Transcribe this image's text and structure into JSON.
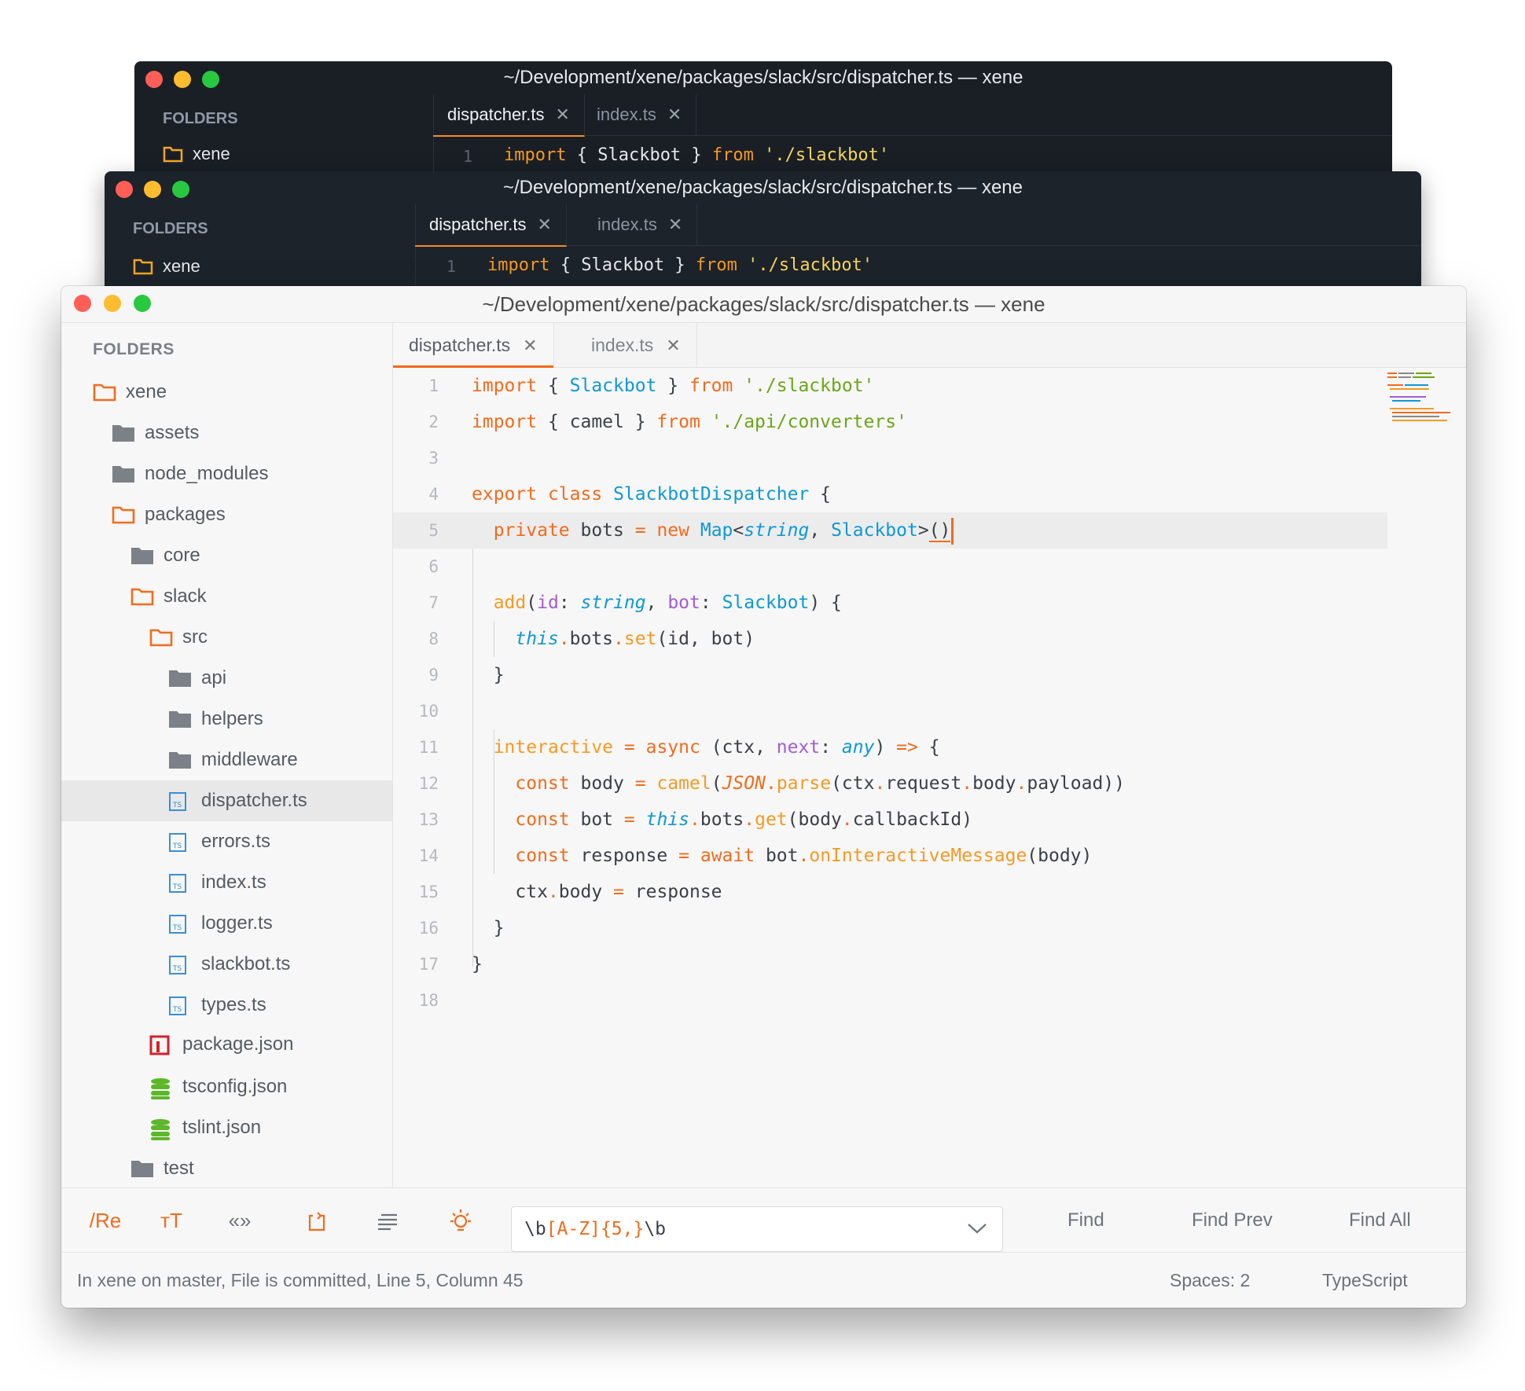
{
  "window_title": "~/Development/xene/packages/slack/src/dispatcher.ts — xene",
  "sidebar_header": "FOLDERS",
  "tabs": [
    {
      "label": "dispatcher.ts",
      "close": "✕"
    },
    {
      "label": "index.ts",
      "close": "✕"
    }
  ],
  "dark_preview": {
    "root_folder": "xene",
    "line_number": "1",
    "code_line": "import { Slackbot } from './slackbot'"
  },
  "tree": [
    {
      "label": "xene",
      "icon": "folder-open-icon"
    },
    {
      "label": "assets",
      "icon": "folder-icon"
    },
    {
      "label": "node_modules",
      "icon": "folder-icon"
    },
    {
      "label": "packages",
      "icon": "folder-open-icon"
    },
    {
      "label": "core",
      "icon": "folder-icon"
    },
    {
      "label": "slack",
      "icon": "folder-open-icon"
    },
    {
      "label": "src",
      "icon": "folder-open-icon"
    },
    {
      "label": "api",
      "icon": "folder-icon"
    },
    {
      "label": "helpers",
      "icon": "folder-icon"
    },
    {
      "label": "middleware",
      "icon": "folder-icon"
    },
    {
      "label": "dispatcher.ts",
      "icon": "typescript-file-icon",
      "selected": true
    },
    {
      "label": "errors.ts",
      "icon": "typescript-file-icon"
    },
    {
      "label": "index.ts",
      "icon": "typescript-file-icon"
    },
    {
      "label": "logger.ts",
      "icon": "typescript-file-icon"
    },
    {
      "label": "slackbot.ts",
      "icon": "typescript-file-icon"
    },
    {
      "label": "types.ts",
      "icon": "typescript-file-icon"
    },
    {
      "label": "package.json",
      "icon": "npm-icon"
    },
    {
      "label": "tsconfig.json",
      "icon": "json-config-icon"
    },
    {
      "label": "tslint.json",
      "icon": "json-config-icon"
    },
    {
      "label": "test",
      "icon": "folder-icon"
    }
  ],
  "line_numbers": [
    "1",
    "2",
    "3",
    "4",
    "5",
    "6",
    "7",
    "8",
    "9",
    "10",
    "11",
    "12",
    "13",
    "14",
    "15",
    "16",
    "17",
    "18"
  ],
  "code_lines": [
    "import { Slackbot } from './slackbot'",
    "import { camel } from './api/converters'",
    "",
    "export class SlackbotDispatcher {",
    "  private bots = new Map<string, Slackbot>()",
    "",
    "  add(id: string, bot: Slackbot) {",
    "    this.bots.set(id, bot)",
    "  }",
    "",
    "  interactive = async (ctx, next: any) => {",
    "    const body = camel(JSON.parse(ctx.request.body.payload))",
    "    const bot = this.bots.get(body.callbackId)",
    "    const response = await bot.onInteractiveMessage(body)",
    "    ctx.body = response",
    "  }",
    "}",
    ""
  ],
  "current_line": 5,
  "find_bar": {
    "regex_toggle": "/Re",
    "case_toggle": "тT",
    "whole_word_toggle": "«»",
    "wrap_toggle": "wrap-icon",
    "in_selection_toggle": "lines-icon",
    "highlight_toggle": "bulb-icon",
    "query": "\\b[A-Z]{5,}\\b",
    "find": "Find",
    "find_prev": "Find Prev",
    "find_all": "Find All"
  },
  "status_bar": {
    "left": "In xene on master, File is committed, Line 5, Column 45",
    "spaces": "Spaces: 2",
    "language": "TypeScript"
  },
  "colors": {
    "accent": "#f26b1d",
    "string": "#6aa617",
    "type": "#0f98d6",
    "param": "#a45cd2",
    "dark_bg": "#1c2128"
  }
}
